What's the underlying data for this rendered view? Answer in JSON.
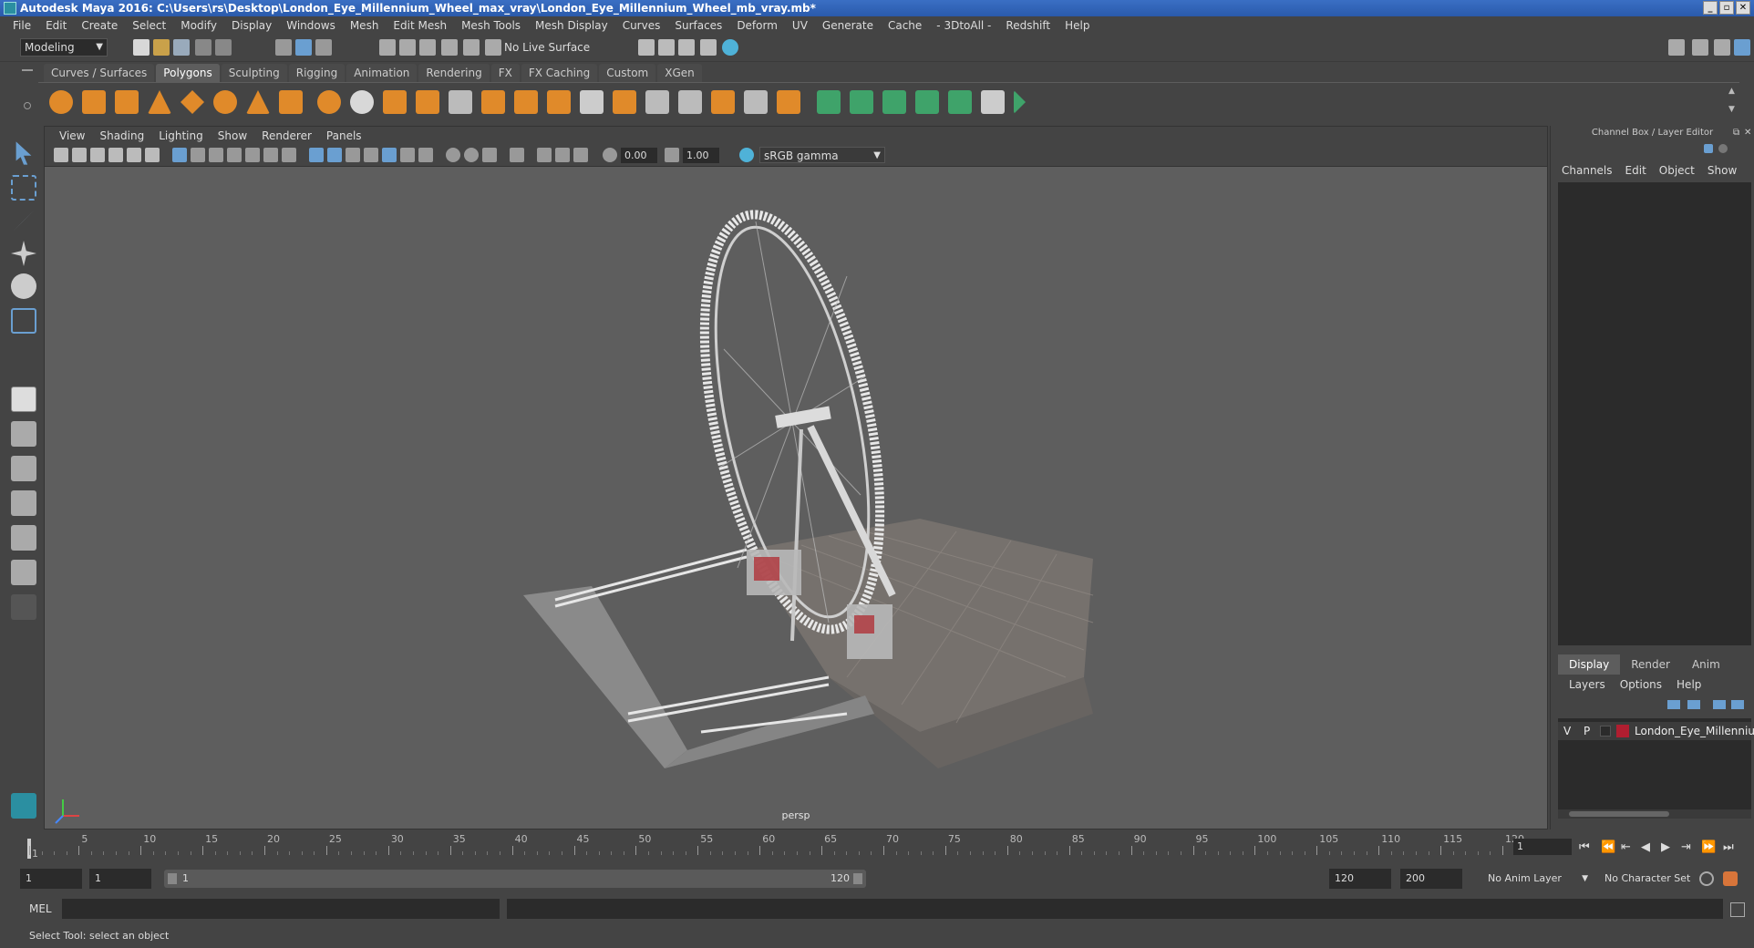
{
  "window": {
    "title": "Autodesk Maya 2016: C:\\Users\\rs\\Desktop\\London_Eye_Millennium_Wheel_max_vray\\London_Eye_Millennium_Wheel_mb_vray.mb*",
    "min": "_",
    "max": "▫",
    "close": "✕"
  },
  "menubar": [
    "File",
    "Edit",
    "Create",
    "Select",
    "Modify",
    "Display",
    "Windows",
    "Mesh",
    "Edit Mesh",
    "Mesh Tools",
    "Mesh Display",
    "Curves",
    "Surfaces",
    "Deform",
    "UV",
    "Generate",
    "Cache",
    "- 3DtoAll -",
    "Redshift",
    "Help"
  ],
  "statusline": {
    "mode": "Modeling",
    "live_surface": "No Live Surface"
  },
  "shelf_tabs": [
    "Curves / Surfaces",
    "Polygons",
    "Sculpting",
    "Rigging",
    "Animation",
    "Rendering",
    "FX",
    "FX Caching",
    "Custom",
    "XGen"
  ],
  "shelf_active": "Polygons",
  "viewport": {
    "menu": [
      "View",
      "Shading",
      "Lighting",
      "Show",
      "Renderer",
      "Panels"
    ],
    "exposure": "0.00",
    "gamma_value": "1.00",
    "colorspace": "sRGB gamma",
    "camera_label": "persp"
  },
  "channel_box": {
    "title": "Channel Box / Layer Editor",
    "menu": [
      "Channels",
      "Edit",
      "Object",
      "Show"
    ]
  },
  "layer_editor": {
    "tabs": [
      "Display",
      "Render",
      "Anim"
    ],
    "active_tab": "Display",
    "menu": [
      "Layers",
      "Options",
      "Help"
    ],
    "layer": {
      "v": "V",
      "p": "P",
      "name": "London_Eye_Millenniu",
      "color": "#b01e30"
    }
  },
  "timeline": {
    "ticks": [
      "1",
      "5",
      "10",
      "15",
      "20",
      "25",
      "30",
      "35",
      "40",
      "45",
      "50",
      "55",
      "60",
      "65",
      "70",
      "75",
      "80",
      "85",
      "90",
      "95",
      "100",
      "105",
      "110",
      "115",
      "120"
    ],
    "current_frame": "1"
  },
  "range": {
    "start": "1",
    "playback_start": "1",
    "slider_start": "1",
    "slider_end": "120",
    "playback_end": "120",
    "end": "200",
    "anim_layer": "No Anim Layer",
    "character_set": "No Character Set"
  },
  "command": {
    "label": "MEL"
  },
  "help_line": "Select Tool: select an object",
  "colors": {
    "accent_tab": "#5d5d5d",
    "shelf_orange": "#e08a2a",
    "shelf_green": "#3fa36a"
  }
}
